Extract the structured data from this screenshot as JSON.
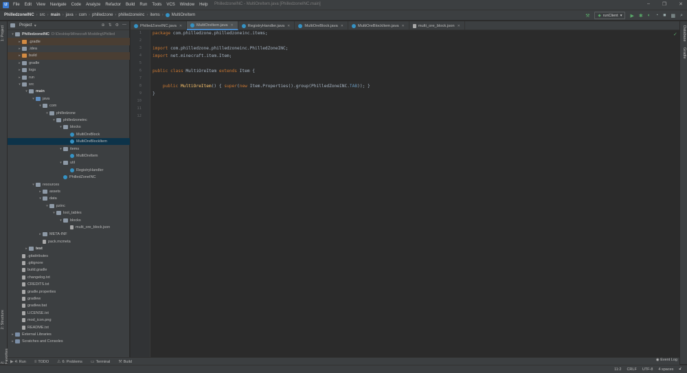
{
  "menubar": {
    "items": [
      "File",
      "Edit",
      "View",
      "Navigate",
      "Code",
      "Analyze",
      "Refactor",
      "Build",
      "Run",
      "Tools",
      "VCS",
      "Window",
      "Help"
    ],
    "window_title": "PhilledzoneINC - MultiOreItem.java [PhilledzoneINC.main]"
  },
  "breadcrumb": [
    "PhilledzoneINC",
    "src",
    "main",
    "java",
    "com",
    "philledzone",
    "philledzoneinc",
    "items",
    "MultiOreItem"
  ],
  "toolbar": {
    "run_config": "runClient"
  },
  "project_panel": {
    "title": "Project",
    "tree": [
      {
        "label": "PhilledzoneINC",
        "hint": "D:\\Desktop\\Minecraft Modding\\Philled",
        "depth": 0,
        "arrow": "▾",
        "icon": "folder",
        "bold": true
      },
      {
        "label": ".gradle",
        "depth": 1,
        "arrow": "▸",
        "icon": "folder-orange",
        "excluded": true
      },
      {
        "label": ".idea",
        "depth": 1,
        "arrow": "▸",
        "icon": "folder"
      },
      {
        "label": "build",
        "depth": 1,
        "arrow": "▸",
        "icon": "folder-orange",
        "excluded": true
      },
      {
        "label": "gradle",
        "depth": 1,
        "arrow": "▸",
        "icon": "folder"
      },
      {
        "label": "logs",
        "depth": 1,
        "arrow": "▸",
        "icon": "folder"
      },
      {
        "label": "run",
        "depth": 1,
        "arrow": "▸",
        "icon": "folder"
      },
      {
        "label": "src",
        "depth": 1,
        "arrow": "▾",
        "icon": "folder"
      },
      {
        "label": "main",
        "depth": 2,
        "arrow": "▾",
        "icon": "folder",
        "bold": true
      },
      {
        "label": "java",
        "depth": 3,
        "arrow": "▾",
        "icon": "folder-blue"
      },
      {
        "label": "com",
        "depth": 4,
        "arrow": "▾",
        "icon": "pkg"
      },
      {
        "label": "philledzone",
        "depth": 5,
        "arrow": "▾",
        "icon": "pkg"
      },
      {
        "label": "philledzoneinc",
        "depth": 6,
        "arrow": "▾",
        "icon": "pkg"
      },
      {
        "label": "blocks",
        "depth": 7,
        "arrow": "▾",
        "icon": "pkg"
      },
      {
        "label": "MultiOreBlock",
        "depth": 8,
        "arrow": "",
        "icon": "class"
      },
      {
        "label": "MultiOreBlockItem",
        "depth": 8,
        "arrow": "",
        "icon": "class",
        "selected": true
      },
      {
        "label": "items",
        "depth": 7,
        "arrow": "▾",
        "icon": "pkg"
      },
      {
        "label": "MultiOreItem",
        "depth": 8,
        "arrow": "",
        "icon": "class"
      },
      {
        "label": "util",
        "depth": 7,
        "arrow": "▾",
        "icon": "pkg"
      },
      {
        "label": "RegistryHandler",
        "depth": 8,
        "arrow": "",
        "icon": "class"
      },
      {
        "label": "PhilledZoneINC",
        "depth": 7,
        "arrow": "",
        "icon": "class"
      },
      {
        "label": "resources",
        "depth": 3,
        "arrow": "▾",
        "icon": "folder"
      },
      {
        "label": "assets",
        "depth": 4,
        "arrow": "▸",
        "icon": "folder"
      },
      {
        "label": "data",
        "depth": 4,
        "arrow": "▾",
        "icon": "folder"
      },
      {
        "label": "pzinc",
        "depth": 5,
        "arrow": "▾",
        "icon": "folder"
      },
      {
        "label": "loot_tables",
        "depth": 6,
        "arrow": "▾",
        "icon": "folder"
      },
      {
        "label": "blocks",
        "depth": 7,
        "arrow": "▾",
        "icon": "folder"
      },
      {
        "label": "multi_ore_block.json",
        "depth": 8,
        "arrow": "",
        "icon": "file"
      },
      {
        "label": "META-INF",
        "depth": 4,
        "arrow": "▸",
        "icon": "folder"
      },
      {
        "label": "pack.mcmeta",
        "depth": 4,
        "arrow": "",
        "icon": "file"
      },
      {
        "label": "test",
        "depth": 2,
        "arrow": "▸",
        "icon": "folder",
        "bold": true
      },
      {
        "label": ".gitattributes",
        "depth": 1,
        "arrow": "",
        "icon": "file"
      },
      {
        "label": ".gitignore",
        "depth": 1,
        "arrow": "",
        "icon": "file"
      },
      {
        "label": "build.gradle",
        "depth": 1,
        "arrow": "",
        "icon": "file"
      },
      {
        "label": "changelog.txt",
        "depth": 1,
        "arrow": "",
        "icon": "file"
      },
      {
        "label": "CREDITS.txt",
        "depth": 1,
        "arrow": "",
        "icon": "file"
      },
      {
        "label": "gradle.properties",
        "depth": 1,
        "arrow": "",
        "icon": "file"
      },
      {
        "label": "gradlew",
        "depth": 1,
        "arrow": "",
        "icon": "file"
      },
      {
        "label": "gradlew.bat",
        "depth": 1,
        "arrow": "",
        "icon": "file"
      },
      {
        "label": "LICENSE.txt",
        "depth": 1,
        "arrow": "",
        "icon": "file"
      },
      {
        "label": "mod_icon.png",
        "depth": 1,
        "arrow": "",
        "icon": "file"
      },
      {
        "label": "README.txt",
        "depth": 1,
        "arrow": "",
        "icon": "file"
      },
      {
        "label": "External Libraries",
        "depth": 0,
        "arrow": "▸",
        "icon": "lib"
      },
      {
        "label": "Scratches and Consoles",
        "depth": 0,
        "arrow": "▸",
        "icon": "lib"
      }
    ]
  },
  "editor_tabs": [
    {
      "label": "PhilledZoneINC.java",
      "active": false
    },
    {
      "label": "MultiOreItem.java",
      "active": true
    },
    {
      "label": "RegistryHandler.java",
      "active": false
    },
    {
      "label": "MultiOreBlock.java",
      "active": false
    },
    {
      "label": "MultiOreBlockItem.java",
      "active": false
    },
    {
      "label": "multi_ore_block.json",
      "active": false
    }
  ],
  "code": {
    "line_numbers": [
      "1",
      "2",
      "3",
      "4",
      "5",
      "6",
      "7",
      "8",
      "9",
      "10",
      "11",
      "12"
    ],
    "line1": {
      "kw": "package",
      "rest": " com.philledzone.philledzoneinc.items;"
    },
    "line3": {
      "kw": "import",
      "rest": " com.philledzone.philledzoneinc.PhilledZoneINC;"
    },
    "line4": {
      "kw": "import",
      "rest": " net.minecraft.item.Item;"
    },
    "line6": {
      "kw1": "public class",
      "name": " MultiOreItem ",
      "kw2": "extends",
      "rest": " Item {"
    },
    "line8": {
      "indent": "    ",
      "kw": "public",
      "fn": " MultiOreItem",
      "a": "() { ",
      "kw2": "super",
      "b": "(",
      "kw3": "new",
      "c": " Item.Properties().group(PhilledZoneINC.",
      "num": "TAB",
      "d": ")); }"
    },
    "line10": {
      "text": "}"
    }
  },
  "left_strip": {
    "project": "1: Project",
    "structure": "2: Structure",
    "favorites": "2: Favorites"
  },
  "right_strip": {
    "database": "Database",
    "gradle": "Gradle"
  },
  "bottom_tabs": [
    {
      "icon": "▶",
      "label": "4: Run"
    },
    {
      "icon": "≡",
      "label": "TODO"
    },
    {
      "icon": "⚠",
      "label": "6: Problems"
    },
    {
      "icon": "▭",
      "label": "Terminal"
    },
    {
      "icon": "⚒",
      "label": "Build"
    }
  ],
  "status": {
    "event_log": "Event Log",
    "position": "11:2",
    "line_sep": "CRLF",
    "encoding": "UTF-8",
    "indent": "4 spaces"
  }
}
